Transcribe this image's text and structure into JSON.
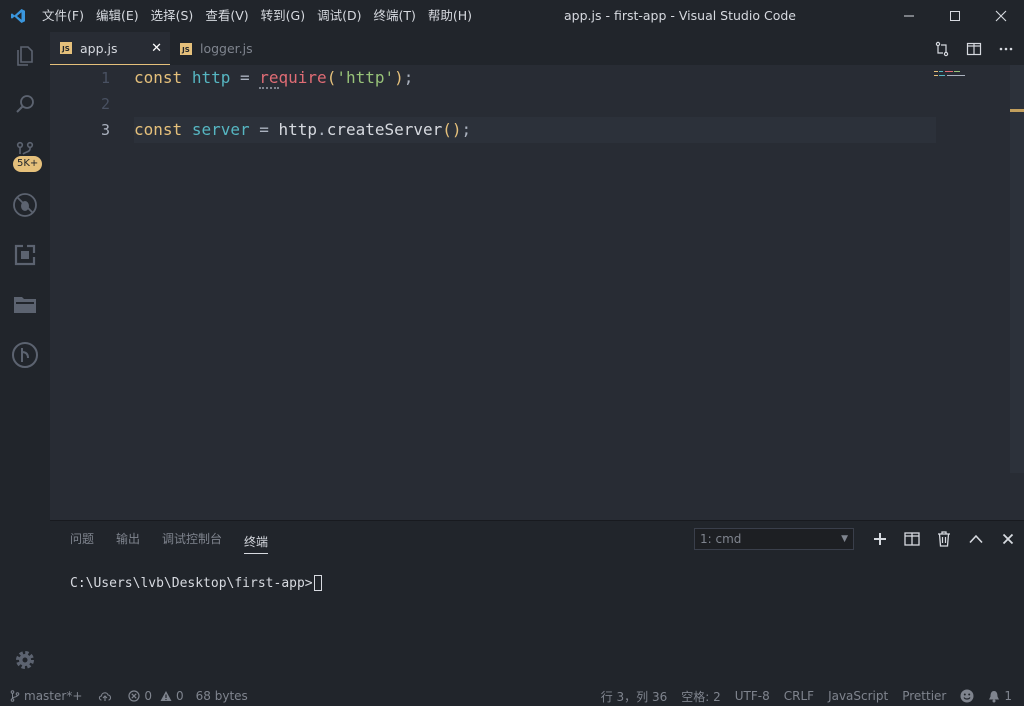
{
  "window": {
    "title": "app.js - first-app - Visual Studio Code"
  },
  "menu": {
    "items": [
      "文件(F)",
      "编辑(E)",
      "选择(S)",
      "查看(V)",
      "转到(G)",
      "调试(D)",
      "终端(T)",
      "帮助(H)"
    ]
  },
  "activity_bar": {
    "scm_badge": "5K+"
  },
  "tabs": [
    {
      "label": "app.js",
      "icon": "JS",
      "close": "✕"
    },
    {
      "label": "logger.js",
      "icon": "JS"
    }
  ],
  "editor": {
    "line_numbers": [
      "1",
      "2",
      "3"
    ],
    "lines": [
      {
        "tokens": [
          {
            "text": "const",
            "cls": "kw"
          },
          {
            "text": " ",
            "cls": "plain"
          },
          {
            "text": "http",
            "cls": "varb"
          },
          {
            "text": " = ",
            "cls": "plain"
          },
          {
            "text": "re",
            "cls": "fn"
          },
          {
            "text": "quire",
            "cls": "fn"
          },
          {
            "text": "(",
            "cls": "paren"
          },
          {
            "text": "'http'",
            "cls": "str"
          },
          {
            "text": ")",
            "cls": "paren"
          },
          {
            "text": ";",
            "cls": "plain"
          }
        ]
      },
      {
        "tokens": []
      },
      {
        "tokens": [
          {
            "text": "const",
            "cls": "kw"
          },
          {
            "text": " ",
            "cls": "plain"
          },
          {
            "text": "server",
            "cls": "varb"
          },
          {
            "text": " = ",
            "cls": "plain"
          },
          {
            "text": "http",
            "cls": "method"
          },
          {
            "text": ".",
            "cls": "plain"
          },
          {
            "text": "createServer",
            "cls": "method"
          },
          {
            "text": "()",
            "cls": "paren"
          },
          {
            "text": ";",
            "cls": "plain"
          }
        ]
      }
    ],
    "current_line": 3
  },
  "panel": {
    "tabs": [
      "问题",
      "输出",
      "调试控制台",
      "终端"
    ],
    "active_tab": "终端",
    "terminal_select": "1: cmd",
    "terminal_prompt": "C:\\Users\\lvb\\Desktop\\first-app>"
  },
  "statusbar": {
    "branch": "master*+",
    "errors": "0",
    "warnings": "0",
    "size": "68 bytes",
    "position": "行 3，列 36",
    "spaces": "空格: 2",
    "encoding": "UTF-8",
    "eol": "CRLF",
    "language": "JavaScript",
    "formatter": "Prettier",
    "notifications": "1"
  },
  "colors": {
    "background": "#282c34",
    "chrome": "#21252b",
    "accent": "#e5c07b",
    "keyword": "#e5c07b",
    "variable": "#56b6c2",
    "function": "#e06c75",
    "string": "#98c379"
  }
}
